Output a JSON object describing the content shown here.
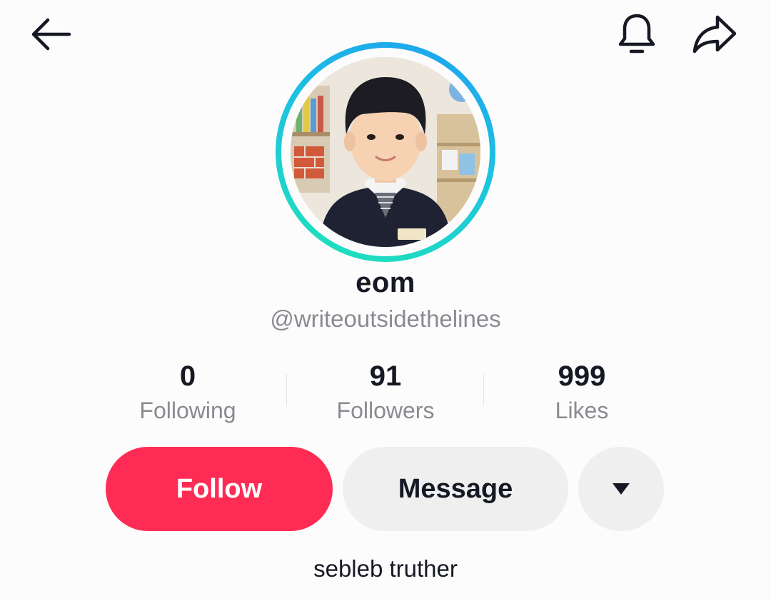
{
  "header": {
    "back_icon": "arrow-left-icon",
    "notification_icon": "bell-icon",
    "share_icon": "share-arrow-icon"
  },
  "profile": {
    "display_name": "eom",
    "username": "@writeoutsidethelines",
    "bio": "sebleb truther",
    "avatar_ring_colors": [
      "#1ea0f0",
      "#20e3b8"
    ]
  },
  "stats": [
    {
      "value": "0",
      "label": "Following"
    },
    {
      "value": "91",
      "label": "Followers"
    },
    {
      "value": "999",
      "label": "Likes"
    }
  ],
  "actions": {
    "follow_label": "Follow",
    "message_label": "Message",
    "more_icon": "caret-down-icon"
  },
  "colors": {
    "accent": "#fe2c55",
    "secondary_button": "#efefef",
    "muted_text": "#8a8b91"
  }
}
